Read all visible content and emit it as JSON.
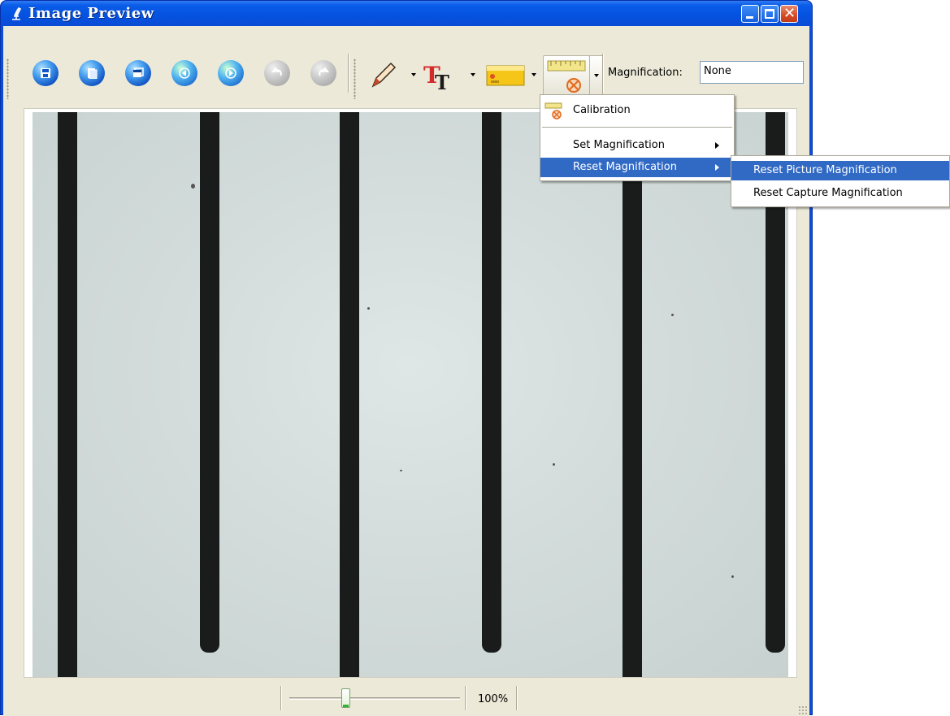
{
  "window": {
    "title": "Image Preview",
    "minimize_icon": "minimize-icon",
    "maximize_icon": "maximize-icon",
    "close_glyph": "✕"
  },
  "toolbar": {
    "buttons": [
      {
        "name": "save-button",
        "icon": "floppy-disk-icon",
        "state": "enabled"
      },
      {
        "name": "copy-button",
        "icon": "copy-document-icon",
        "state": "enabled"
      },
      {
        "name": "full-screen-button",
        "icon": "window-icon",
        "state": "enabled"
      },
      {
        "name": "previous-button",
        "icon": "arrow-left-icon",
        "state": "enabled"
      },
      {
        "name": "next-button",
        "icon": "arrow-right-icon",
        "state": "enabled"
      },
      {
        "name": "undo-button",
        "icon": "undo-icon",
        "state": "disabled"
      },
      {
        "name": "redo-button",
        "icon": "redo-icon",
        "state": "disabled"
      },
      {
        "name": "draw-button",
        "icon": "pencil-icon",
        "state": "enabled"
      },
      {
        "name": "text-button",
        "icon": "text-tt-icon",
        "state": "enabled"
      },
      {
        "name": "measure-button",
        "icon": "ruler-icon",
        "state": "enabled"
      },
      {
        "name": "calibration-button",
        "icon": "ruler-calibration-icon",
        "state": "pressed"
      }
    ],
    "magnification_label": "Magnification:",
    "magnification_value": "None"
  },
  "calibration_menu": {
    "items": [
      {
        "label": "Calibration",
        "icon": "calibration-icon"
      },
      {
        "label": "Set Magnification",
        "has_submenu": true
      },
      {
        "label": "Reset Magnification",
        "has_submenu": true,
        "highlighted": true
      }
    ]
  },
  "reset_submenu": {
    "items": [
      {
        "label": "Reset Picture Magnification",
        "highlighted": true
      },
      {
        "label": "Reset Capture Magnification"
      }
    ]
  },
  "statusbar": {
    "zoom_value": "100%",
    "zoom_slider_fraction": 0.33
  },
  "colors": {
    "titlebar": "#0a5ce8",
    "menu_highlight": "#316ac5",
    "window_face": "#ece9d8"
  }
}
